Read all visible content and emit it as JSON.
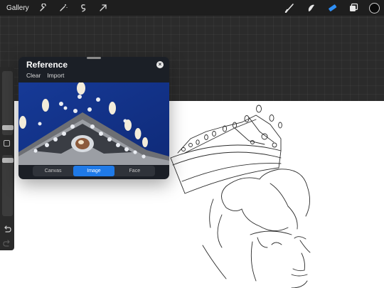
{
  "topbar": {
    "gallery_label": "Gallery",
    "left_icons": [
      "wrench-icon",
      "magic-wand-icon",
      "selection-icon",
      "transform-arrow-icon"
    ],
    "right_icons": [
      "brush-icon",
      "smudge-icon",
      "eraser-icon",
      "layers-icon"
    ],
    "active_tool": "eraser-icon",
    "accent_color": "#1f7ae8",
    "current_color": "#0b0b0b"
  },
  "sidebar": {
    "brush_size_level": 0.55,
    "opacity_level": 0.78,
    "icons": [
      "modify-button-icon",
      "undo-icon",
      "redo-icon"
    ]
  },
  "reference": {
    "title": "Reference",
    "clear_label": "Clear",
    "import_label": "Import",
    "close_icon": "close-icon",
    "tabs": [
      {
        "label": "Canvas",
        "active": false
      },
      {
        "label": "Image",
        "active": true
      },
      {
        "label": "Face",
        "active": false
      }
    ]
  }
}
